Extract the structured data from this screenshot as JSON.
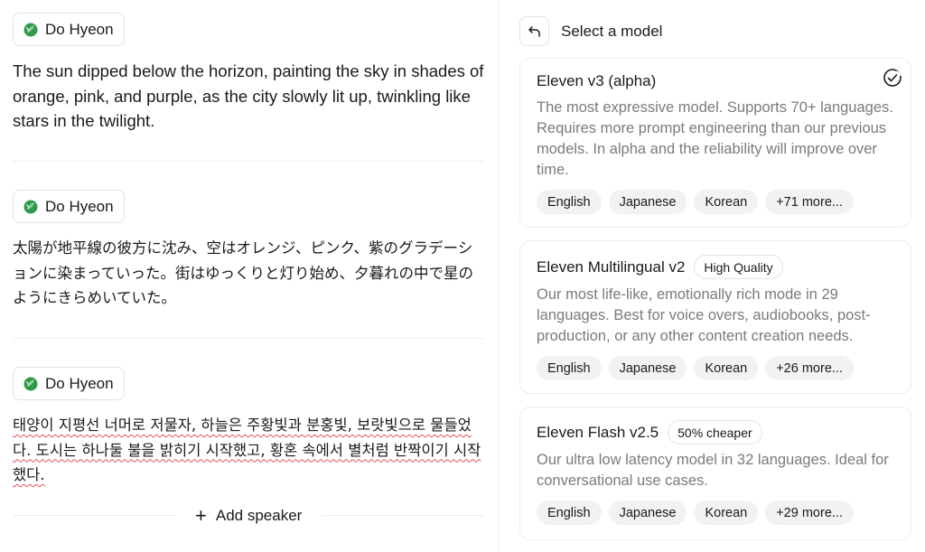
{
  "speaker_blocks": [
    {
      "speaker": "Do Hyeon",
      "text": "The sun dipped below the horizon, painting the sky in shades of orange, pink, and purple, as the city slowly lit up, twinkling like stars in the twilight."
    },
    {
      "speaker": "Do Hyeon",
      "text": "太陽が地平線の彼方に沈み、空はオレンジ、ピンク、紫のグラデーションに染まっていった。街はゆっくりと灯り始め、夕暮れの中で星のようにきらめいていた。"
    },
    {
      "speaker": "Do Hyeon",
      "text": "태양이 지평선 너머로 저물자, 하늘은 주황빛과 분홍빛, 보랏빛으로 물들었다. 도시는 하나둘 불을 밝히기 시작했고, 황혼 속에서 별처럼 반짝이기 시작했다."
    }
  ],
  "add_speaker_label": "Add speaker",
  "panel": {
    "title": "Select a model",
    "back_icon": "undo-arrow-icon",
    "models": [
      {
        "name": "Eleven v3 (alpha)",
        "badge": "",
        "selected": true,
        "description": "The most expressive model. Supports 70+ languages. Requires more prompt engineering than our previous models. In alpha and the reliability will improve over time.",
        "languages": [
          "English",
          "Japanese",
          "Korean",
          "+71 more..."
        ]
      },
      {
        "name": "Eleven Multilingual v2",
        "badge": "High Quality",
        "selected": false,
        "description": "Our most life-like, emotionally rich mode in 29 languages. Best for voice overs, audiobooks, post-production, or any other content creation needs.",
        "languages": [
          "English",
          "Japanese",
          "Korean",
          "+26 more..."
        ]
      },
      {
        "name": "Eleven Flash v2.5",
        "badge": "50% cheaper",
        "selected": false,
        "description": "Our ultra low latency model in 32 languages. Ideal for conversational use cases.",
        "languages": [
          "English",
          "Japanese",
          "Korean",
          "+29 more..."
        ]
      }
    ]
  },
  "colors": {
    "avatar_green": "#2e9b4a",
    "avatar_light": "#8fd19e",
    "muted_text": "#7b7b7b",
    "pill_bg": "#f2f2f2",
    "border": "#e3e3e3"
  }
}
